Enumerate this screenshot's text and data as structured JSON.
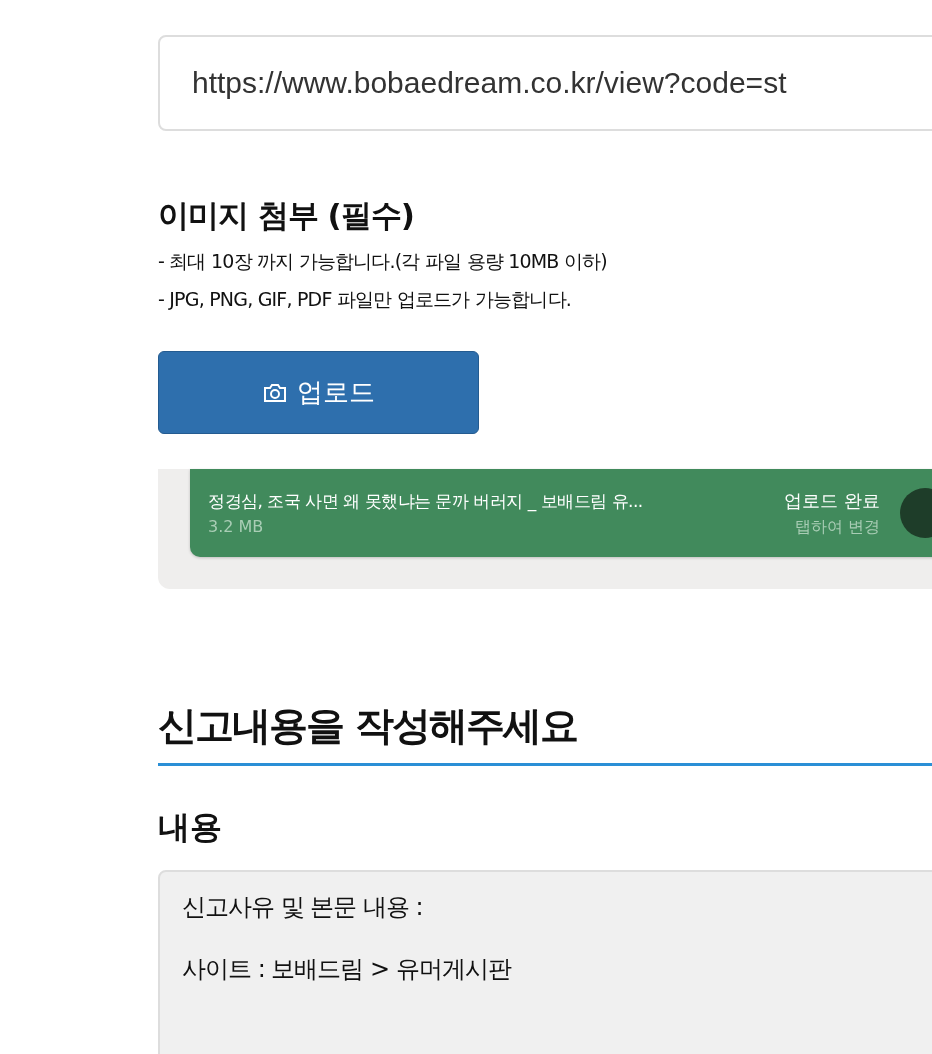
{
  "url_field": {
    "value": "https://www.bobaedream.co.kr/view?code=st"
  },
  "image_section": {
    "title": "이미지 첨부 (필수)",
    "notes": [
      "- 최대 10장 까지 가능합니다.(각 파일 용량 10MB 이하)",
      "- JPG, PNG, GIF, PDF 파일만 업로드가 가능합니다."
    ],
    "upload_button": "업로드",
    "files": [
      {
        "name": "정경심, 조국 사면 왜 못했냐는 문까 버러지 _ 보배드림 유...",
        "size": "3.2 MB",
        "status": "업로드 완료",
        "hint": "탭하여 변경"
      }
    ]
  },
  "report_section": {
    "title": "신고내용을 작성해주세요",
    "content_label": "내용",
    "content": "신고사유 및 본문 내용 :\n\n사이트 : 보배드림 > 유머게시판"
  }
}
